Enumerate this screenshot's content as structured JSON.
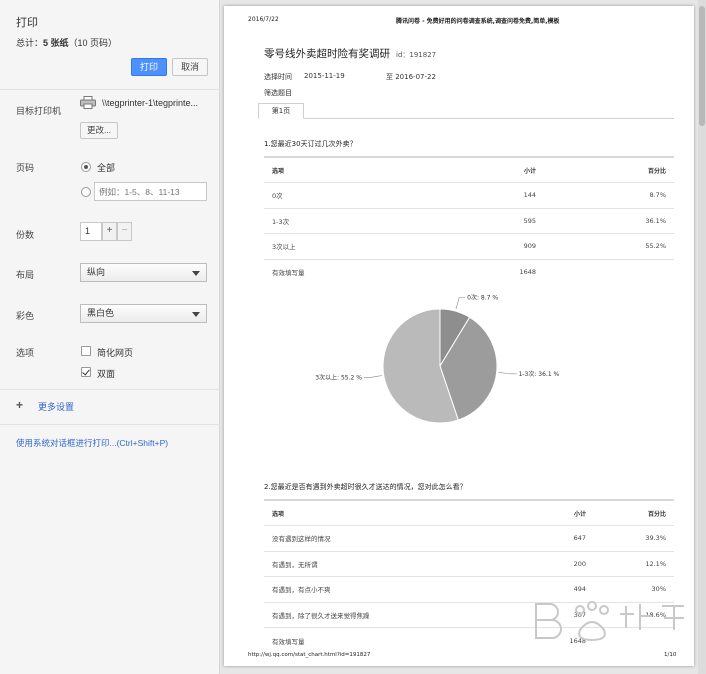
{
  "sidebar": {
    "title": "打印",
    "total_prefix": "总计：",
    "total_sheets": "5 张纸",
    "total_pages": "（10 页码）",
    "print_button": "打印",
    "cancel_button": "取消",
    "destination_label": "目标打印机",
    "printer_name": "\\\\tegprinter-1\\tegprinte...",
    "change_button": "更改...",
    "pages_label": "页码",
    "pages_all": "全部",
    "pages_range_placeholder": "例如：1-5、8、11-13",
    "copies_label": "份数",
    "copies_value": "1",
    "plus": "+",
    "minus": "−",
    "layout_label": "布局",
    "layout_value": "纵向",
    "color_label": "彩色",
    "color_value": "黑白色",
    "options_label": "选项",
    "opt_simplify": "简化网页",
    "opt_duplex": "双面",
    "more_settings_plus": "+",
    "more_settings": "更多设置",
    "system_dialog": "使用系统对话框进行打印...(Ctrl+Shift+P)"
  },
  "page": {
    "header_date": "2016/7/22",
    "header_site": "腾讯问卷 - 免费好用的问卷调查系统,调查问卷免费,简单,模板",
    "survey_title": "零号线外卖超时险有奖调研",
    "survey_id": "id：191827",
    "time_label": "选择时间",
    "time_start": "2015-11-19",
    "time_to": "至 2016-07-22",
    "filter_label": "筛选题目",
    "tab_label": "第1页",
    "footer_url": "http://wj.qq.com/stat_chart.html?id=191827",
    "footer_page": "1/10"
  },
  "q1": {
    "title": "1.您最近30天订过几次外卖？",
    "headers": [
      "选项",
      "小计",
      "百分比"
    ],
    "rows": [
      {
        "option": "0次",
        "count": "144",
        "pct": "8.7%"
      },
      {
        "option": "1-3次",
        "count": "595",
        "pct": "36.1%"
      },
      {
        "option": "3次以上",
        "count": "909",
        "pct": "55.2%"
      }
    ],
    "valid_label": "有效填写量",
    "valid_count": "1648"
  },
  "q2": {
    "title": "2.您最近是否有遇到外卖超时很久才送达的情况，您对此怎么看？",
    "headers": [
      "选项",
      "小计",
      "百分比"
    ],
    "rows": [
      {
        "option": "没有遇到这样的情况",
        "count": "647",
        "pct": "39.3%"
      },
      {
        "option": "有遇到，无所谓",
        "count": "200",
        "pct": "12.1%"
      },
      {
        "option": "有遇到，有点小不爽",
        "count": "494",
        "pct": "30%"
      },
      {
        "option": "有遇到，除了很久才送来觉得焦躁",
        "count": "307",
        "pct": "18.6%"
      }
    ],
    "valid_label": "有效填写量",
    "valid_count": "1648"
  },
  "chart_data": {
    "type": "pie",
    "slices": [
      {
        "label": "0次: 8.7 %",
        "value": 8.7,
        "color": "#8e8e8e"
      },
      {
        "label": "1-3次: 36.1 %",
        "value": 36.1,
        "color": "#9c9c9c"
      },
      {
        "label": "3次以上: 55.2 %",
        "value": 55.2,
        "color": "#bababa"
      }
    ]
  },
  "colors": {
    "accent": "#4d90fe",
    "link": "#3366cc",
    "panel_bg": "#f5f5f5"
  },
  "icons": [
    "printer-icon",
    "dropdown-caret-icon",
    "plus-icon",
    "checkbox-check-icon"
  ]
}
